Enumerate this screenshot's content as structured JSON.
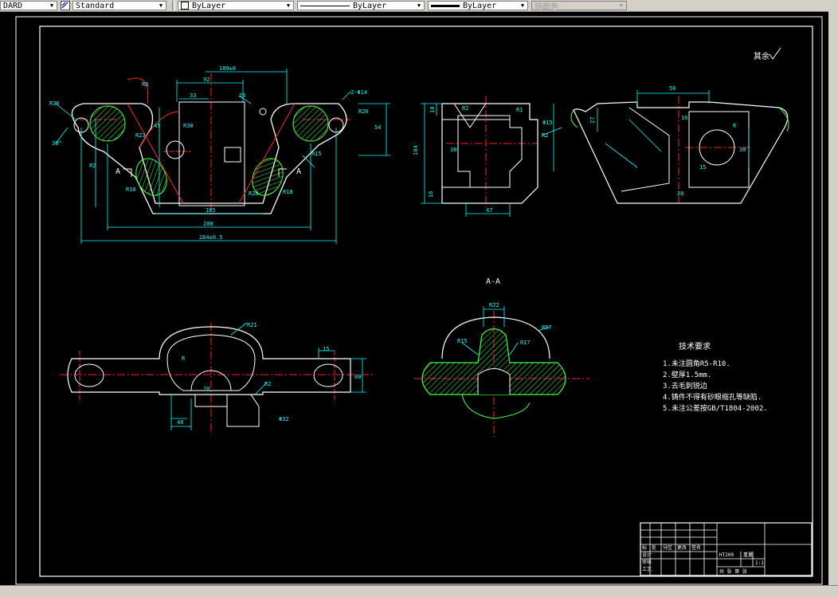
{
  "toolbar": {
    "text_style": "DARD",
    "dim_style": "Standard",
    "layer": "ByLayer",
    "linetype": "ByLayer",
    "lineweight": "ByLayer",
    "plot_style": "随颜色"
  },
  "drawing": {
    "section_title": "A-A",
    "section_mark_left": "A",
    "section_mark_right": "A",
    "roughness_note": "其余",
    "tech_title": "技术要求",
    "tech_notes": [
      "1.未注圆角R5-R10.",
      "2.壁厚1.5mm.",
      "3.去毛刺锐边",
      "4.铸件不得有砂眼缩孔等缺陷.",
      "5.未注公差按GB/T1804-2002."
    ],
    "dims_front": [
      "R36",
      "R26",
      "R20",
      "2-Φ14",
      "33",
      "92",
      "189",
      "3",
      "45",
      "R30",
      "R23",
      "R15",
      "25",
      "6",
      "185",
      "208",
      "264±0.5",
      "R10",
      "R18",
      "R28",
      "R6",
      "R15",
      "A"
    ],
    "dims_side": [
      "10",
      "R2",
      "72",
      "104",
      "47",
      "16",
      "Φ15",
      "38"
    ],
    "dims_right": [
      "50",
      "27",
      "R",
      "30",
      "28"
    ],
    "dims_bottom": [
      "R21",
      "R",
      "20",
      "60",
      "15",
      "40",
      "R2"
    ],
    "dims_section": [
      "R22",
      "R15",
      "R17",
      "R57"
    ],
    "title_block": {
      "scale_cell": "1:1",
      "sheet": "共 张 第 张",
      "material": "HT200"
    }
  },
  "colors": {
    "background": "#000000",
    "cyan": "#00ffff",
    "white": "#ffffff",
    "red": "#ff2020",
    "green": "#00ff00",
    "hatch": "#40ff40"
  }
}
